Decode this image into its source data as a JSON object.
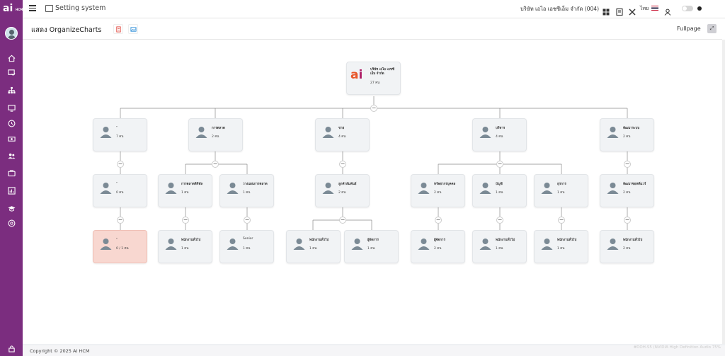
{
  "brand": {
    "logo_text": "ai",
    "logo_sub": "HCM",
    "accent_color": "#7b2d7f",
    "logo_color_a": "#e8562a",
    "logo_color_i": "#b0226a"
  },
  "sidebar": {
    "items": [
      {
        "icon": "home-icon"
      },
      {
        "icon": "checklist-icon"
      },
      {
        "icon": "org-tree-icon"
      },
      {
        "icon": "monitor-icon"
      },
      {
        "icon": "clock-icon"
      },
      {
        "icon": "money-icon"
      },
      {
        "icon": "users-icon"
      },
      {
        "icon": "briefcase-icon"
      },
      {
        "icon": "report-icon"
      },
      {
        "icon": "graduation-icon"
      },
      {
        "icon": "settings-circle-icon"
      }
    ],
    "bottom_icon": "lock-icon"
  },
  "topbar": {
    "title": "Setting system",
    "company": "บริษัท เอไอ เอชซีเอ็ม จำกัด (004)",
    "language": "ไทย"
  },
  "page": {
    "title": "แสดง OrganizeCharts",
    "fullpage_label": "Fullpage",
    "pdf_icon_color": "#e0463c",
    "image_icon_color": "#2f8fd8"
  },
  "org": {
    "root": {
      "name": "บริษัท เอไอ เอชซี เอ็ม จำกัด",
      "count": "27 คน"
    },
    "level1": [
      {
        "name": "-",
        "count": "7 คน"
      },
      {
        "name": "การตลาด",
        "count": "2 คน"
      },
      {
        "name": "ขาย",
        "count": "4 คน"
      },
      {
        "name": "บริหาร",
        "count": "4 คน"
      },
      {
        "name": "พัฒนาระบบ",
        "count": "2 คน"
      }
    ],
    "level2": [
      {
        "name": "-",
        "count": "0 คน"
      },
      {
        "name": "การตลาดดิจิทัล",
        "count": "1 คน"
      },
      {
        "name": "วางแผนการตลาด",
        "count": "1 คน"
      },
      {
        "name": "ลูกค้าสัมพันธ์",
        "count": "2 คน"
      },
      {
        "name": "ทรัพยากรบุคคล",
        "count": "2 คน"
      },
      {
        "name": "บัญชี",
        "count": "1 คน"
      },
      {
        "name": "ธุรการ",
        "count": "1 คน"
      },
      {
        "name": "พัฒนาซอฟต์แวร์",
        "count": "2 คน"
      }
    ],
    "level3": [
      {
        "name": "-",
        "count": "0 / 1 คน"
      },
      {
        "name": "พนักงานทั่วไป",
        "count": "1 คน"
      },
      {
        "name": "Senior",
        "count": "1 คน"
      },
      {
        "name": "พนักงานทั่วไป",
        "count": "1 คน"
      },
      {
        "name": "ผู้จัดการ",
        "count": "1 คน"
      },
      {
        "name": "ผู้จัดการ",
        "count": "2 คน"
      },
      {
        "name": "พนักงานทั่วไป",
        "count": "1 คน"
      },
      {
        "name": "พนักงานทั่วไป",
        "count": "1 คน"
      },
      {
        "name": "พนักงานทั่วไป",
        "count": "2 คน"
      }
    ],
    "collapse_symbol": "−"
  },
  "footer": {
    "copyright": "Copyright © 2025 AI HCM",
    "audio_text": "#DOH-S5 (NVIDIA High Definition Audio 75%"
  }
}
